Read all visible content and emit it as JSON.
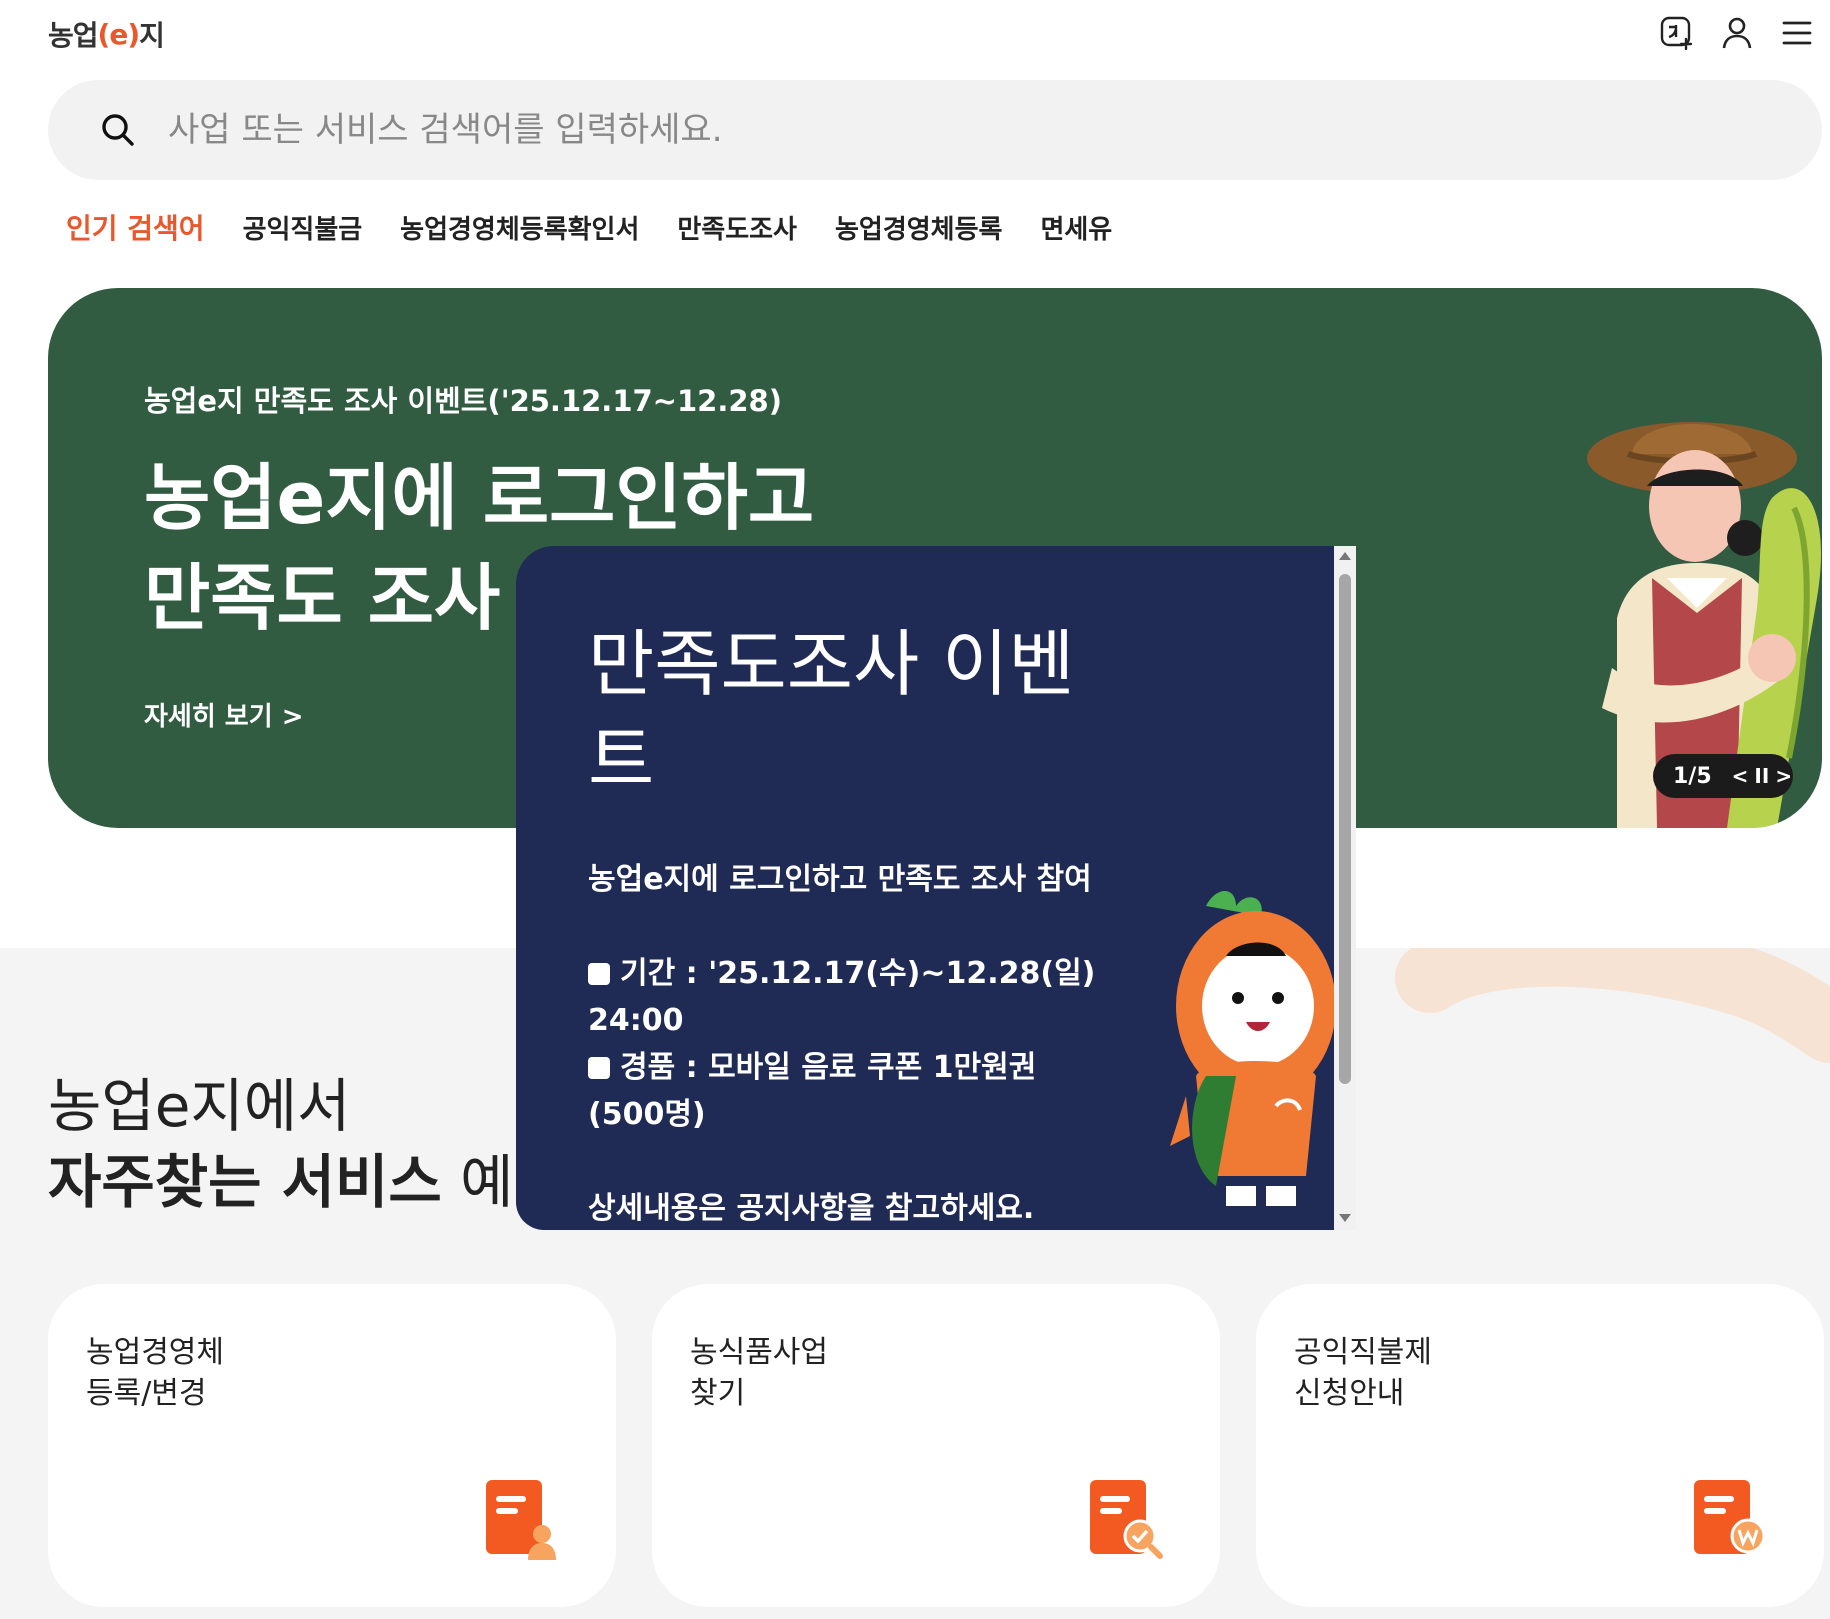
{
  "header": {
    "logo_prefix": "농업",
    "logo_paren_open": "(",
    "logo_e": "e",
    "logo_paren_close": ")",
    "logo_suffix": "지",
    "icons": [
      "language-icon",
      "user-icon",
      "menu-icon"
    ]
  },
  "search": {
    "placeholder": "사업 또는 서비스 검색어를 입력하세요."
  },
  "popular": {
    "title": "인기 검색어",
    "keywords": [
      "공익직불금",
      "농업경영체등록확인서",
      "만족도조사",
      "농업경영체등록",
      "면세유"
    ]
  },
  "banner": {
    "subtitle": "농업e지 만족도 조사 이벤트('25.12.17~12.28)",
    "title_line1": "농업e지에 로그인하고",
    "title_line2": "만족도 조사 참여",
    "more": "자세히 보기 >",
    "pager_text": "1/5",
    "pager_prev": "<",
    "pager_pause": "II",
    "pager_next": ">"
  },
  "section": {
    "title_line1": "농업e지에서",
    "title_line2_bold": "자주찾는 서비스",
    "title_line2_rest": " 예요"
  },
  "cards": [
    {
      "line1": "농업경영체",
      "line2": "등록/변경",
      "icon": "document-user-icon"
    },
    {
      "line1": "농식품사업",
      "line2": "찾기",
      "icon": "document-search-icon"
    },
    {
      "line1": "공익직불제",
      "line2": "신청안내",
      "icon": "document-won-icon"
    }
  ],
  "popup": {
    "title": "만족도조사 이벤트",
    "intro": "농업e지에 로그인하고 만족도 조사 참여",
    "period": "기간 : '25.12.17(수)~12.28(일) 24:00",
    "prize": "경품 : 모바일 음료 쿠폰 1만원권(500명)",
    "notice": "상세내용은 공지사항을 참고하세요."
  },
  "colors": {
    "accent": "#e9572b",
    "banner_bg": "#325c42",
    "popup_bg": "#1f2a55",
    "section_bg": "#f4f4f4"
  }
}
